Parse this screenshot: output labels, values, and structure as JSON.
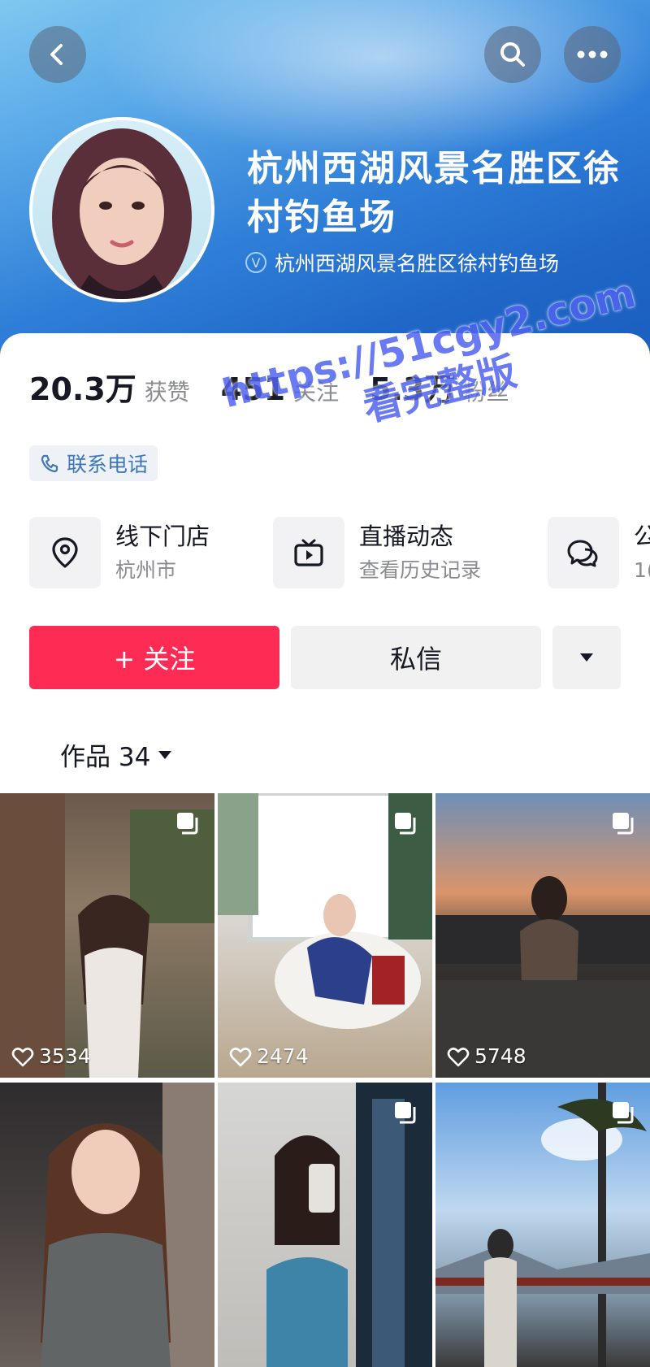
{
  "header": {
    "profile_name": "杭州西湖风景名胜区徐村钓鱼场",
    "verified_text": "杭州西湖风景名胜区徐村钓鱼场",
    "gradient_color": "#2f7fd8"
  },
  "stats": [
    {
      "value": "20.3万",
      "label": "获赞"
    },
    {
      "value": "451",
      "label": "关注"
    },
    {
      "value": "5.3万",
      "label": "粉丝"
    }
  ],
  "contact": {
    "label": "联系电话",
    "color": "#3f77b8"
  },
  "services": [
    {
      "icon": "location-icon",
      "title": "线下门店",
      "subtitle": "杭州市"
    },
    {
      "icon": "tv-live-icon",
      "title": "直播动态",
      "subtitle": "查看历史记录"
    },
    {
      "icon": "chat-icon",
      "title": "公",
      "subtitle": "1("
    }
  ],
  "actions": {
    "follow_label": "+ 关注",
    "message_label": "私信",
    "follow_color": "#fe2c55"
  },
  "tab": {
    "label": "作品 34"
  },
  "watermark": {
    "line1": "https://51cgy2.com",
    "line2": "看完整版"
  },
  "grid": [
    {
      "likes": "3534"
    },
    {
      "likes": "2474"
    },
    {
      "likes": "5748"
    },
    {
      "likes": ""
    },
    {
      "likes": ""
    },
    {
      "likes": ""
    }
  ]
}
